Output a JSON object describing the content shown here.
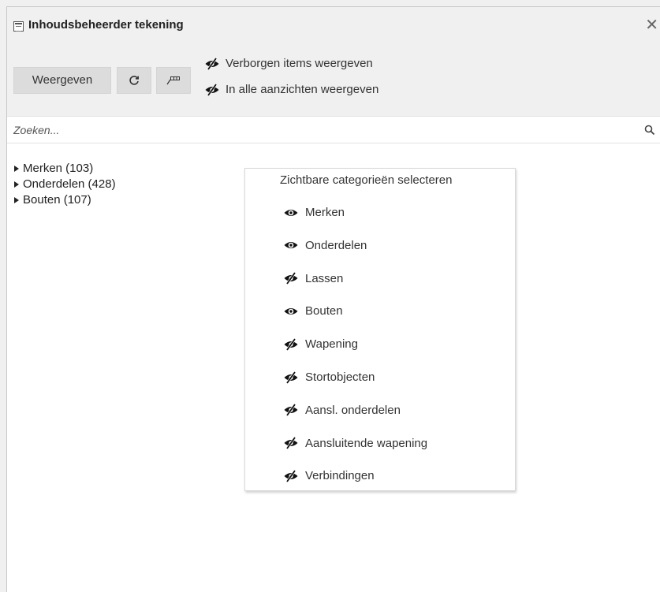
{
  "window": {
    "title": "Inhoudsbeheerder tekening",
    "close_icon": "close-icon",
    "title_icon": "panel-icon"
  },
  "toolbar": {
    "show_label": "Weergeven",
    "refresh_icon": "refresh-icon",
    "tag_icon": "tag-icon",
    "options": [
      {
        "label": "Verborgen items weergeven",
        "icon": "eye-hidden-icon"
      },
      {
        "label": "In alle aanzichten weergeven",
        "icon": "eye-hidden-icon"
      }
    ]
  },
  "search": {
    "placeholder": "Zoeken...",
    "value": "",
    "icon": "search-icon"
  },
  "tree": {
    "items": [
      {
        "label": "Merken (103)"
      },
      {
        "label": "Onderdelen (428)"
      },
      {
        "label": "Bouten (107)"
      }
    ]
  },
  "popup": {
    "title": "Zichtbare categorieën selecteren",
    "categories": [
      {
        "label": "Merken",
        "visible": true
      },
      {
        "label": "Onderdelen",
        "visible": true
      },
      {
        "label": "Lassen",
        "visible": false
      },
      {
        "label": "Bouten",
        "visible": true
      },
      {
        "label": "Wapening",
        "visible": false
      },
      {
        "label": "Stortobjecten",
        "visible": false
      },
      {
        "label": "Aansl. onderdelen",
        "visible": false
      },
      {
        "label": "Aansluitende wapening",
        "visible": false
      },
      {
        "label": "Verbindingen",
        "visible": false
      }
    ]
  },
  "colors": {
    "background": "#f0f0f0",
    "content": "#ffffff",
    "button": "#dcdcdc",
    "text": "#222222"
  }
}
